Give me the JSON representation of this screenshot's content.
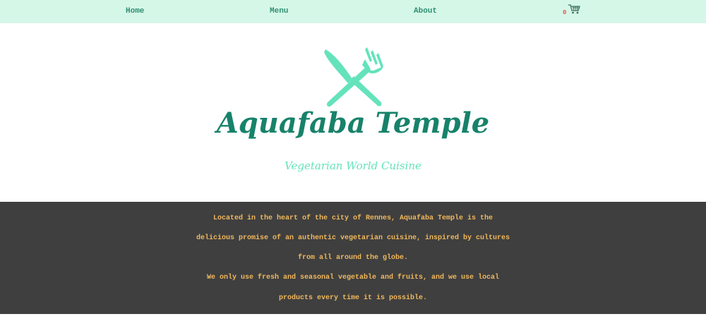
{
  "nav": {
    "home_label": "Home",
    "menu_label": "Menu",
    "about_label": "About",
    "cart_count": "0"
  },
  "hero": {
    "title": "Aquafaba Temple",
    "tagline": "Vegetarian World Cuisine"
  },
  "info": {
    "lines": [
      "Located in the heart of the city of Rennes, Aquafaba Temple is the",
      "delicious promise of an authentic vegetarian cuisine, inspired by cultures",
      "from all around the globe.",
      "We only use fresh and seasonal vegetable and fruits, and we use local",
      "products every time it is possible."
    ]
  },
  "colors": {
    "nav_background": "#d5f7e8",
    "nav_text": "#2e8f73",
    "brand": "#17826a",
    "accent": "#64e3bb",
    "info_background": "#3f3f3f",
    "info_text": "#f1b85c",
    "cart_count": "#e8545a"
  },
  "icons": {
    "cart": "shopping-cart-icon",
    "logo": "crossed-knife-fork-icon"
  }
}
